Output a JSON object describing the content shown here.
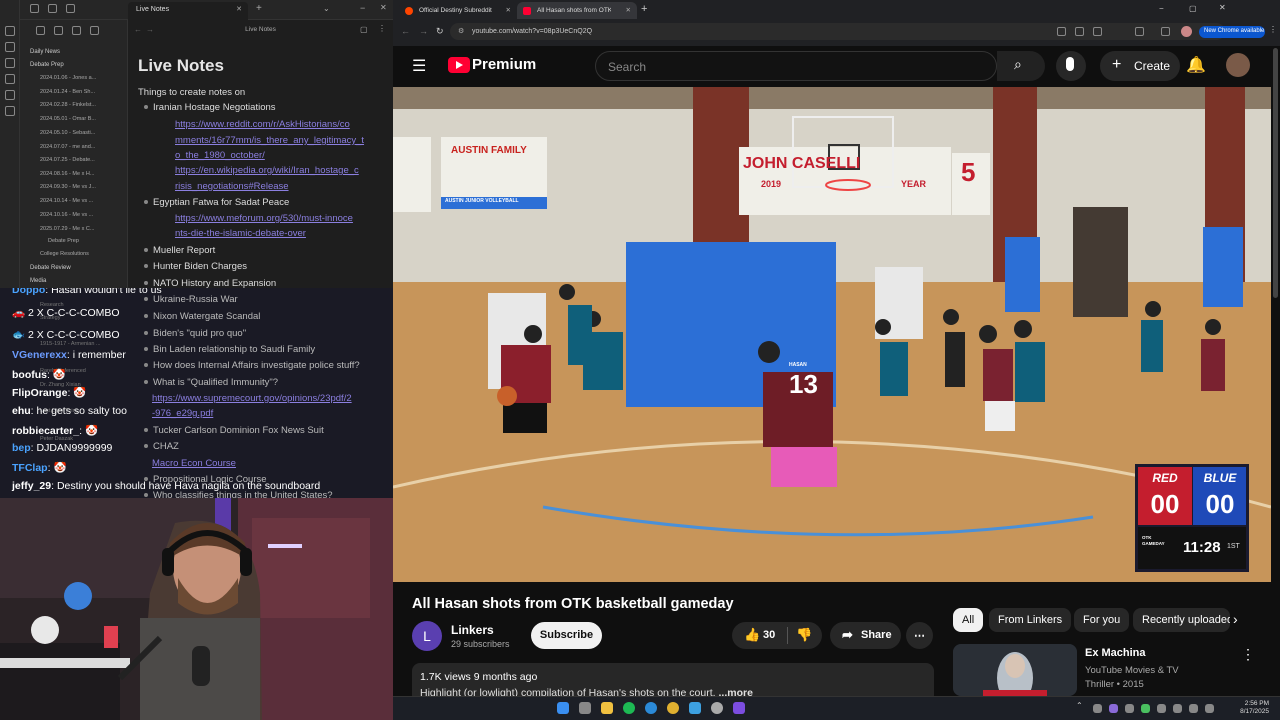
{
  "obsidian": {
    "tab_title": "Live Notes",
    "header_title": "Live Notes",
    "file_tree": [
      "Daily News",
      "Debate Prep",
      "2024.01.06 - Jones a...",
      "2024.01.24 - Ben Sh...",
      "2024.02.28 - Finkelst...",
      "2024.05.01 - Omar B...",
      "2024.05.10 - Sebasti...",
      "2024.07.07 - me and...",
      "2024.07.25 - Debate...",
      "2024.08.16 - Me x H...",
      "2024.09.30 - Me vs J...",
      "2024.10.14 - Me vs ...",
      "2024.10.16 - Me vs ...",
      "2025.07.29 - Me x C...",
      "Debate Prep",
      "College Resolutions",
      "Debate Review",
      "Media"
    ],
    "note_title": "Live Notes",
    "intro": "Things to create notes on",
    "items": {
      "iran": "Iranian Hostage Negotiations",
      "link1a": "https://www.reddit.com/r/AskHistorians/co",
      "link1b": "mments/16r77mm/is_there_any_legitimacy_t",
      "link1c": "o_the_1980_october/",
      "link2a": "https://en.wikipedia.org/wiki/Iran_hostage_c",
      "link2b": "risis_negotiations#Release",
      "egypt": "Egyptian Fatwa for Sadat Peace",
      "link3a": "https://www.meforum.org/530/must-innoce",
      "link3b": "nts-die-the-islamic-debate-over",
      "mueller": "Mueller Report",
      "hunter": "Hunter Biden Charges",
      "nato": "NATO History and Expansion",
      "ukraine": "Ukraine-Russia War",
      "nixon": "Nixon Watergate Scandal",
      "biden": "Biden's \"quid pro quo\"",
      "binladen": "Bin Laden relationship to Saudi Family",
      "police": "How does Internal Affairs investigate police stuff?",
      "qi": "What is \"Qualified Immunity\"?",
      "link4a": "https://www.supremecourt.gov/opinions/23pdf/2",
      "link4b": "-976_e29g.pdf",
      "tucker": "Tucker Carlson Dominion Fox News Suit",
      "chaz": "CHAZ",
      "macro": "Macro Econ Course",
      "logic": "Propositional Logic Course",
      "who": "Who classifies things in the United States?"
    },
    "ghost_tree": [
      "Research",
      "Strategy",
      "1915-1917 - Armenian ...",
      "Rarely Referenced",
      "Dr. Zhang Xixian",
      "Last Little Thing",
      "Peter Daszak"
    ]
  },
  "chat": [
    {
      "user": "Doppo",
      "text": "Hasan wouldn't lie to us",
      "color": "#4aa3ff"
    },
    {
      "user": "",
      "text": "2 X C-C-C-COMBO",
      "color": "#ffffff"
    },
    {
      "user": "",
      "text": "2 X C-C-C-COMBO",
      "color": "#ffffff"
    },
    {
      "user": "VGenerexx",
      "text": "i remember",
      "color": "#6c9cff"
    },
    {
      "user": "boofus",
      "text": "",
      "color": "#ffffff"
    },
    {
      "user": "FlipOrange",
      "text": "",
      "color": "#ffffff"
    },
    {
      "user": "ehu",
      "text": "he gets so salty too",
      "color": "#ffffff"
    },
    {
      "user": "robbiecarter_",
      "text": "",
      "color": "#ffffff"
    },
    {
      "user": "bep",
      "text": "DJDAN9999999",
      "color": "#4aa3ff"
    },
    {
      "user": "TFClap",
      "text": "",
      "color": "#4aa3ff"
    },
    {
      "user": "jeffy_29",
      "text": "Destiny you should have Hava nagila on the soundboard",
      "color": "#ffffff"
    }
  ],
  "browser": {
    "tabs": [
      "Official Destiny Subreddit",
      "All Hasan shots from OTK b..."
    ],
    "url": "youtube.com/watch?v=08p3UeCnQ2Q",
    "new_chrome": "New Chrome available"
  },
  "youtube": {
    "logo": "Premium",
    "search_placeholder": "Search",
    "create": "Create",
    "video_title": "All Hasan shots from OTK basketball gameday",
    "channel": "Linkers",
    "channel_initial": "L",
    "subscribers": "29 subscribers",
    "subscribe": "Subscribe",
    "likes": "30",
    "share": "Share",
    "views": "1.7K views",
    "age": "9 months ago",
    "description": "Highlight (or lowlight) compilation of Hasan's shots on the court.",
    "more": "...more",
    "chips": [
      "All",
      "From Linkers",
      "For you",
      "Recently uploaded"
    ],
    "rec_title": "Ex Machina",
    "rec_channel": "YouTube Movies & TV",
    "rec_meta": "Thriller • 2015",
    "banner1": "AUSTIN FAMILY",
    "banner2": "AUSTIN JUNIOR VOLLEYBALL",
    "banner3": "JOHN CASELLI",
    "banner4": "2019",
    "banner5": "YEAR",
    "banner6": "5",
    "jersey": "13",
    "jersey_name": "HASAN",
    "score": {
      "red_label": "RED",
      "blue_label": "BLUE",
      "red": "00",
      "blue": "00",
      "clock": "11:28",
      "period": "1ST",
      "logo": "OTK GAMEDAY"
    }
  },
  "taskbar": {
    "time": "2:56 PM",
    "date": "8/17/2025"
  }
}
